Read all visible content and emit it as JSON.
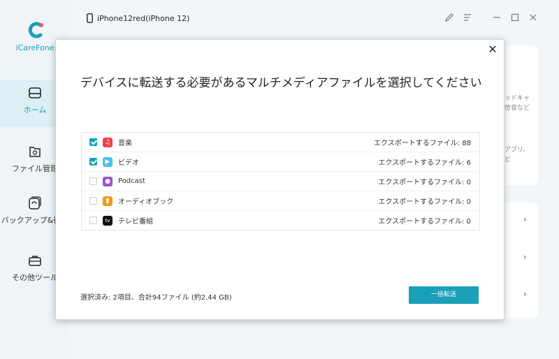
{
  "app": {
    "name": "iCareFone",
    "device": "iPhone12red(iPhone 12)"
  },
  "sidebar": {
    "items": [
      {
        "label": "ホーム"
      },
      {
        "label": "ファイル管理"
      },
      {
        "label": "バックアップ&復元"
      },
      {
        "label": "その他ツール"
      }
    ]
  },
  "background": {
    "text1": "ッドキャ\n信音など",
    "text2": "アプリ、\nど"
  },
  "modal": {
    "title": "デバイスに転送する必要があるマルチメディアファイルを選択してください",
    "rows": [
      {
        "label": "音楽",
        "count": "エクスポートするファイル: 88",
        "checked": true,
        "icon": "music-icon",
        "color": "#f0434f"
      },
      {
        "label": "ビデオ",
        "count": "エクスポートするファイル: 6",
        "checked": true,
        "icon": "video-icon",
        "color": "#49c4e8"
      },
      {
        "label": "Podcast",
        "count": "エクスポートするファイル: 0",
        "checked": false,
        "icon": "podcast-icon",
        "color": "#9b53d6"
      },
      {
        "label": "オーディオブック",
        "count": "エクスポートするファイル: 0",
        "checked": false,
        "icon": "audiobook-icon",
        "color": "#f39a1b"
      },
      {
        "label": "テレビ番組",
        "count": "エクスポートするファイル: 0",
        "checked": false,
        "icon": "tv-icon",
        "color": "#111111"
      }
    ],
    "status": "選択済み: 2項目、合計94ファイル (約2.44 GB)",
    "button": "一括転送"
  },
  "colors": {
    "accent": "#1a9fb8"
  }
}
